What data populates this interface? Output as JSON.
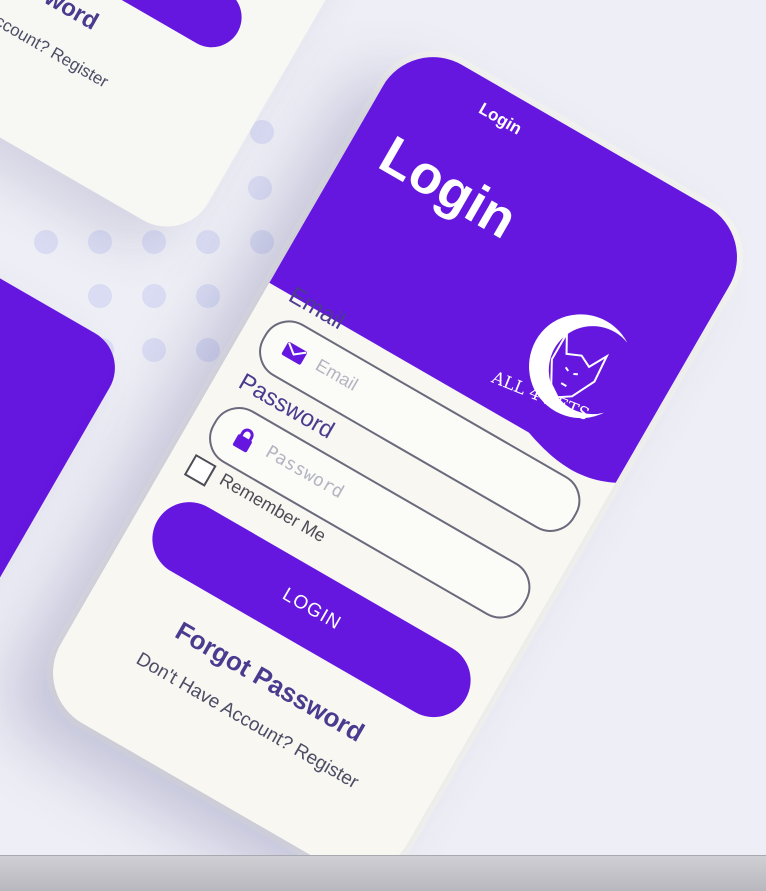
{
  "back_phone": {
    "forgot_password": "Password",
    "register_link": "Have Account? Register"
  },
  "main_phone": {
    "top_label": "Login",
    "title": "Login",
    "logo_text": "ALL 4 PETS",
    "email": {
      "label": "Email",
      "placeholder": "Email"
    },
    "password": {
      "label": "Password",
      "placeholder": "Password"
    },
    "remember_me": "Remember Me",
    "login_button": "LOGIN",
    "forgot_password": "Forgot Password",
    "register_link": "Don't Have Account? Register"
  },
  "colors": {
    "brand": "#6517e0",
    "label_text": "#4b3b8f",
    "background": "#eeeef6"
  },
  "icons": {
    "email": "envelope-icon",
    "password": "lock-icon",
    "logo": "dog-moon-icon"
  }
}
